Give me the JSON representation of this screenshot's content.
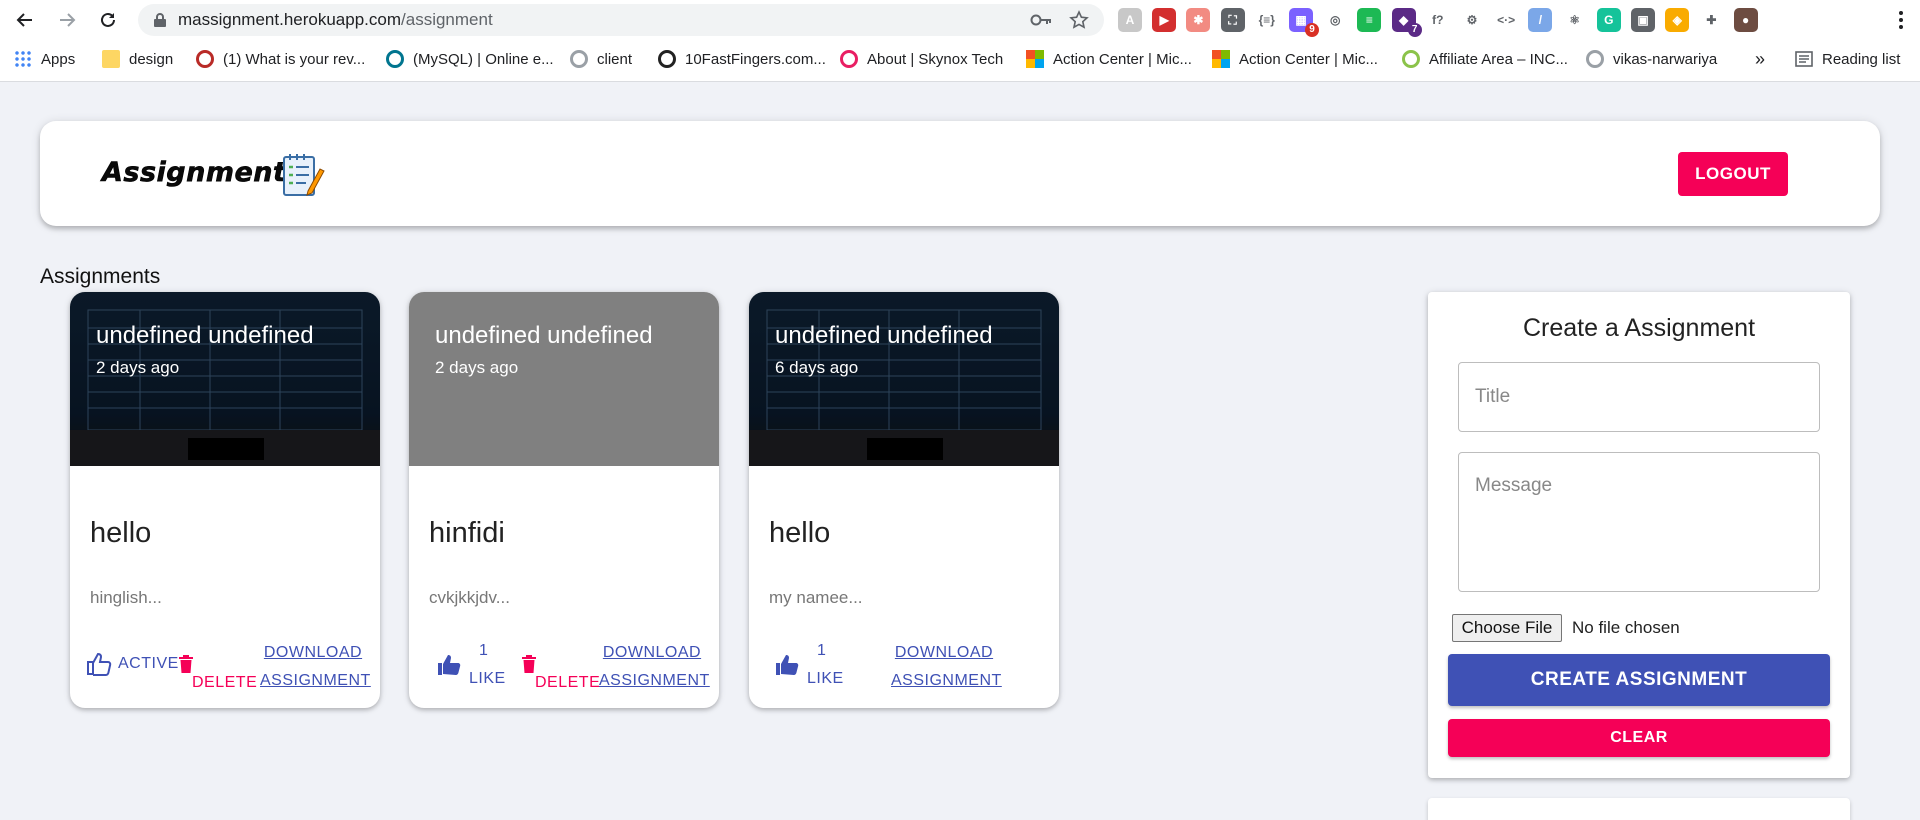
{
  "browser": {
    "url_host": "massignment.herokuapp.com",
    "url_path": "/assignment",
    "extensions": [
      {
        "icon": "ext-a-icon",
        "color": "#c8c8c8",
        "glyph": "A"
      },
      {
        "icon": "ext-red-play-icon",
        "color": "#d32f2f",
        "glyph": "▶"
      },
      {
        "icon": "ext-grid-icon",
        "color": "#f28b82",
        "glyph": "✱"
      },
      {
        "icon": "ext-screenshot-icon",
        "color": "#5f6368",
        "glyph": "⛶"
      },
      {
        "icon": "ext-json-icon",
        "color": "#ffffff",
        "glyph": "{≡}"
      },
      {
        "icon": "ext-badge-icon",
        "color": "#7b61ff",
        "glyph": "▦",
        "badge": "9",
        "badge_color": "#d93025"
      },
      {
        "icon": "ext-glasses-icon",
        "color": "#ffffff",
        "glyph": "◎"
      },
      {
        "icon": "ext-green-icon",
        "color": "#1db954",
        "glyph": "≡"
      },
      {
        "icon": "ext-purple-badge-icon",
        "color": "#5b2a86",
        "glyph": "◆",
        "badge": "7",
        "badge_color": "#5b2a86"
      },
      {
        "icon": "ext-function-icon",
        "color": "#ffffff",
        "glyph": "f?"
      },
      {
        "icon": "ext-gear-icon",
        "color": "#ffffff",
        "glyph": "⚙"
      },
      {
        "icon": "ext-code-icon",
        "color": "#ffffff",
        "glyph": "<·>"
      },
      {
        "icon": "ext-blue-circle-icon",
        "color": "#7ba7e8",
        "glyph": "/"
      },
      {
        "icon": "ext-react-icon",
        "color": "#ffffff",
        "glyph": "⚛"
      },
      {
        "icon": "ext-grammarly-icon",
        "color": "#15c39a",
        "glyph": "G"
      },
      {
        "icon": "ext-monitor-icon",
        "color": "#5f6368",
        "glyph": "▣"
      },
      {
        "icon": "ext-yellow-icon",
        "color": "#f9ab00",
        "glyph": "◈"
      },
      {
        "icon": "extensions-puzzle-icon",
        "color": "#ffffff",
        "glyph": "✚"
      },
      {
        "icon": "profile-avatar-icon",
        "color": "#6d4c41",
        "glyph": "●"
      }
    ],
    "bookmarks": [
      {
        "label": "Apps",
        "icon": "apps-grid-icon",
        "color": "#ea4335"
      },
      {
        "label": "design",
        "icon": "folder-icon",
        "color": "#fdd663"
      },
      {
        "label": "(1) What is your rev...",
        "icon": "quora-icon",
        "color": "#b92b27"
      },
      {
        "label": "(MySQL) | Online e...",
        "icon": "mysql-icon",
        "color": "#00758f"
      },
      {
        "label": "client",
        "icon": "github-icon",
        "color": "#9aa0a6"
      },
      {
        "label": "10FastFingers.com...",
        "icon": "tenfastfingers-icon",
        "color": "#222222"
      },
      {
        "label": "About | Skynox Tech",
        "icon": "skynox-icon",
        "color": "#e91e63"
      },
      {
        "label": "Action Center | Mic...",
        "icon": "microsoft-icon",
        "color": "#f25022"
      },
      {
        "label": "Action Center | Mic...",
        "icon": "microsoft-icon",
        "color": "#f25022"
      },
      {
        "label": "Affiliate Area – INC...",
        "icon": "affiliate-icon",
        "color": "#8bc34a"
      },
      {
        "label": "vikas-narwariya",
        "icon": "github-icon",
        "color": "#9aa0a6"
      }
    ],
    "more_bookmarks": "»",
    "reading_list": "Reading list"
  },
  "app": {
    "brand": "Assignment",
    "logout_label": "LOGOUT"
  },
  "assignments_heading": "Assignments",
  "cards": [
    {
      "creator": "undefined undefined",
      "age": "2 days ago",
      "title": "hello",
      "message": "hinglish...",
      "like_label": "ACTIVE",
      "like_mode": "outline",
      "delete_label": "DELETE",
      "download_line1": "DOWNLOAD",
      "download_line2": "ASSIGNMENT",
      "media": "photo"
    },
    {
      "creator": "undefined undefined",
      "age": "2 days ago",
      "title": "hinfidi",
      "message": "cvkjkkjdv...",
      "like_count": "1",
      "like_word": "LIKE",
      "like_mode": "filled",
      "delete_label": "DELETE",
      "download_line1": "DOWNLOAD",
      "download_line2": "ASSIGNMENT",
      "media": "plain"
    },
    {
      "creator": "undefined undefined",
      "age": "6 days ago",
      "title": "hello",
      "message": "my namee...",
      "like_count": "1",
      "like_word": "LIKE",
      "like_mode": "filled",
      "download_line1": "DOWNLOAD",
      "download_line2": "ASSIGNMENT",
      "media": "photo"
    }
  ],
  "form": {
    "heading": "Create a Assignment",
    "title_placeholder": "Title",
    "message_placeholder": "Message",
    "file_button": "Choose File",
    "file_status": "No file chosen",
    "create_label": "CREATE ASSIGNMENT",
    "clear_label": "CLEAR"
  },
  "colors": {
    "primary": "#3f51b5",
    "secondary": "#f50057",
    "background": "#f0f2f7"
  }
}
